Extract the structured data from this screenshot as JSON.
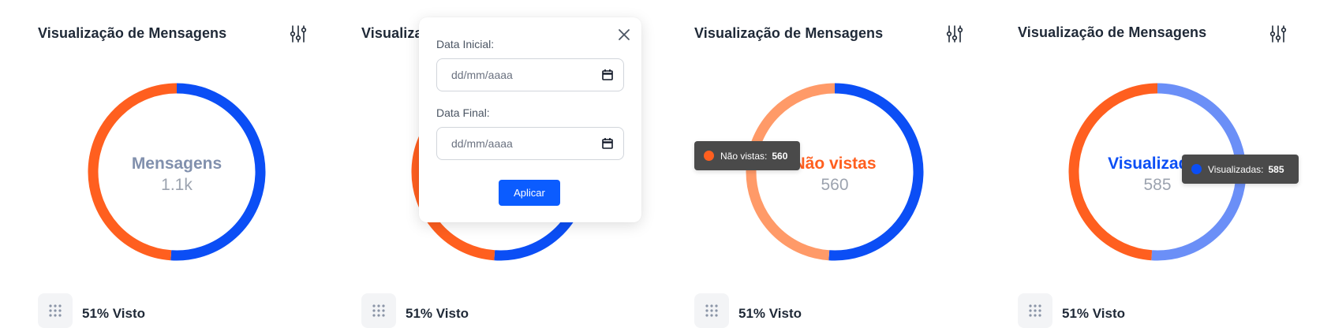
{
  "colors": {
    "blue": "#0b4ef5",
    "orange": "#ff5f1f",
    "orange_faded": "#ff9a68",
    "blue_faded": "#6b8ff7",
    "tooltip_bg": "#4a4a4a",
    "apply_button": "#0b5cff"
  },
  "cards": [
    {
      "title": "Visualização de Mensagens",
      "center_label": "Mensagens",
      "center_label_color": "#8190ad",
      "center_value": "1.1k",
      "footer_text": "51% Visto",
      "highlight": "none"
    },
    {
      "title": "Visualização de Mensagens",
      "center_label": "",
      "center_value": "",
      "footer_text": "51% Visto",
      "highlight": "none"
    },
    {
      "title": "Visualização de Mensagens",
      "center_label": "Não vistas",
      "center_label_color": "#ff5f1f",
      "center_value": "560",
      "footer_text": "51% Visto",
      "highlight": "nao_vistas",
      "tooltip": {
        "label": "Não vistas:",
        "value": "560",
        "color": "#ff5f1f"
      }
    },
    {
      "title": "Visualização de Mensagens",
      "center_label": "Visualizadas",
      "center_label_color": "#0b4ef5",
      "center_value": "585",
      "footer_text": "51% Visto",
      "highlight": "visualizadas",
      "tooltip": {
        "label": "Visualizadas:",
        "value": "585",
        "color": "#0b4ef5"
      }
    }
  ],
  "chart_data": [
    {
      "type": "pie",
      "series": [
        {
          "name": "Visualizadas",
          "value": 585,
          "color": "#0b4ef5"
        },
        {
          "name": "Não vistas",
          "value": 560,
          "color": "#ff5f1f"
        }
      ],
      "center_label": "Mensagens",
      "center_value": "1.1k"
    },
    {
      "type": "pie",
      "series": [
        {
          "name": "Visualizadas",
          "value": 585,
          "color": "#0b4ef5"
        },
        {
          "name": "Não vistas",
          "value": 560,
          "color": "#ff5f1f"
        }
      ]
    },
    {
      "type": "pie",
      "series": [
        {
          "name": "Visualizadas",
          "value": 585,
          "color": "#0b4ef5"
        },
        {
          "name": "Não vistas",
          "value": 560,
          "color": "#ff5f1f"
        }
      ],
      "center_label": "Não vistas",
      "center_value": "560"
    },
    {
      "type": "pie",
      "series": [
        {
          "name": "Visualizadas",
          "value": 585,
          "color": "#0b4ef5"
        },
        {
          "name": "Não vistas",
          "value": 560,
          "color": "#ff5f1f"
        }
      ],
      "center_label": "Visualizadas",
      "center_value": "585"
    }
  ],
  "date_filter": {
    "start_label": "Data Inicial:",
    "start_placeholder": "dd/mm/aaaa",
    "end_label": "Data Final:",
    "end_placeholder": "dd/mm/aaaa",
    "apply_label": "Aplicar"
  },
  "icons": {
    "settings": "sliders-icon",
    "grid": "grid-dots-icon",
    "close": "close-icon",
    "calendar": "calendar-icon"
  }
}
